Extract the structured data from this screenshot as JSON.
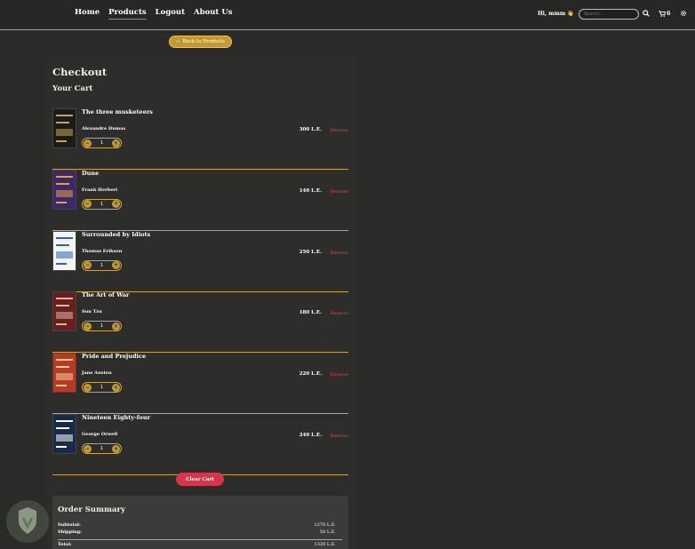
{
  "nav": {
    "links": [
      "Home",
      "Products",
      "Logout",
      "About Us"
    ],
    "greeting": "Hi, mmm 👋",
    "search_placeholder": "Search...",
    "cart_count": "6"
  },
  "back_button": "Back to Products",
  "page_title": "Checkout",
  "cart_title": "Your Cart",
  "items": [
    {
      "title": "The three musketeers",
      "author": "Alexandre Dumas",
      "qty": "1",
      "price": "300 L.E.",
      "remove": "Remove",
      "cover_color": "#1b1b1b",
      "accent": "#c9a546"
    },
    {
      "title": "Dune",
      "author": "Frank Herbert",
      "qty": "1",
      "price": "140 L.E.",
      "remove": "Remove",
      "cover_color": "#3b2a6a",
      "accent": "#e6a03a"
    },
    {
      "title": "Surrounded by Idiots",
      "author": "Thomas Erikson",
      "qty": "1",
      "price": "250 L.E.",
      "remove": "Remove",
      "cover_color": "#f4f4f2",
      "accent": "#2a62c6"
    },
    {
      "title": "The Art of War",
      "author": "Sun Tzu",
      "qty": "1",
      "price": "180 L.E.",
      "remove": "Remove",
      "cover_color": "#6a1f1f",
      "accent": "#d8b8a0"
    },
    {
      "title": "Pride and Prejudice",
      "author": "Jane Austen",
      "qty": "1",
      "price": "220 L.E.",
      "remove": "Remove",
      "cover_color": "#b63a2a",
      "accent": "#f0d090"
    },
    {
      "title": "Nineteen Eighty-four",
      "author": "George Orwell",
      "qty": "1",
      "price": "240 L.E.",
      "remove": "Remove",
      "cover_color": "#1a2a4a",
      "accent": "#ffffff"
    }
  ],
  "clear_button": "Clear Cart",
  "summary": {
    "title": "Order Summary",
    "subtotal_label": "Subtotal:",
    "subtotal_value": "1270 L.E.",
    "shipping_label": "Shipping:",
    "shipping_value": "50 L.E.",
    "total_label": "Total:",
    "total_value": "1320 L.E."
  },
  "colors": {
    "accent": "#c9a546",
    "danger": "#d8344a",
    "background": "#2a2b29"
  }
}
